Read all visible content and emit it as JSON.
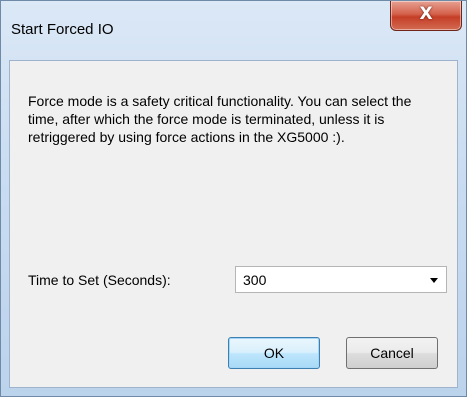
{
  "window": {
    "title": "Start Forced IO",
    "close_glyph": "X"
  },
  "dialog": {
    "message": "Force mode is a safety critical functionality. You can select the time, after which the force mode is terminated, unless it is retriggered by using force actions in the XG5000 :).",
    "time_label": "Time to Set (Seconds):",
    "time_value": "300",
    "ok_label": "OK",
    "cancel_label": "Cancel"
  },
  "icons": {
    "close": "close-icon",
    "dropdown": "chevron-down-icon"
  }
}
